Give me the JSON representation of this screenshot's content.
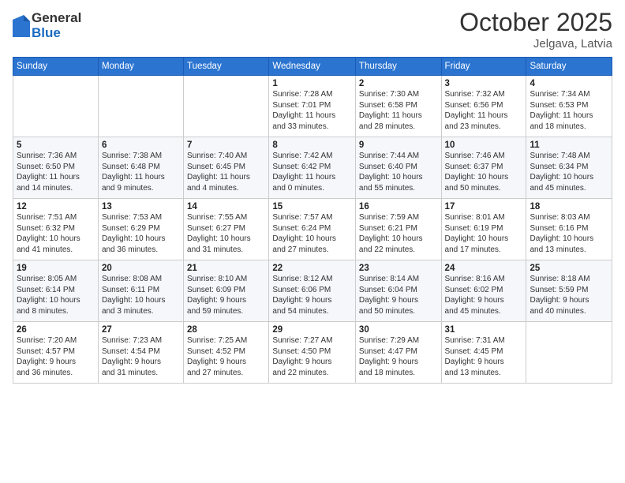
{
  "logo": {
    "general": "General",
    "blue": "Blue"
  },
  "header": {
    "month": "October 2025",
    "location": "Jelgava, Latvia"
  },
  "weekdays": [
    "Sunday",
    "Monday",
    "Tuesday",
    "Wednesday",
    "Thursday",
    "Friday",
    "Saturday"
  ],
  "weeks": [
    [
      {
        "day": "",
        "info": ""
      },
      {
        "day": "",
        "info": ""
      },
      {
        "day": "",
        "info": ""
      },
      {
        "day": "1",
        "info": "Sunrise: 7:28 AM\nSunset: 7:01 PM\nDaylight: 11 hours\nand 33 minutes."
      },
      {
        "day": "2",
        "info": "Sunrise: 7:30 AM\nSunset: 6:58 PM\nDaylight: 11 hours\nand 28 minutes."
      },
      {
        "day": "3",
        "info": "Sunrise: 7:32 AM\nSunset: 6:56 PM\nDaylight: 11 hours\nand 23 minutes."
      },
      {
        "day": "4",
        "info": "Sunrise: 7:34 AM\nSunset: 6:53 PM\nDaylight: 11 hours\nand 18 minutes."
      }
    ],
    [
      {
        "day": "5",
        "info": "Sunrise: 7:36 AM\nSunset: 6:50 PM\nDaylight: 11 hours\nand 14 minutes."
      },
      {
        "day": "6",
        "info": "Sunrise: 7:38 AM\nSunset: 6:48 PM\nDaylight: 11 hours\nand 9 minutes."
      },
      {
        "day": "7",
        "info": "Sunrise: 7:40 AM\nSunset: 6:45 PM\nDaylight: 11 hours\nand 4 minutes."
      },
      {
        "day": "8",
        "info": "Sunrise: 7:42 AM\nSunset: 6:42 PM\nDaylight: 11 hours\nand 0 minutes."
      },
      {
        "day": "9",
        "info": "Sunrise: 7:44 AM\nSunset: 6:40 PM\nDaylight: 10 hours\nand 55 minutes."
      },
      {
        "day": "10",
        "info": "Sunrise: 7:46 AM\nSunset: 6:37 PM\nDaylight: 10 hours\nand 50 minutes."
      },
      {
        "day": "11",
        "info": "Sunrise: 7:48 AM\nSunset: 6:34 PM\nDaylight: 10 hours\nand 45 minutes."
      }
    ],
    [
      {
        "day": "12",
        "info": "Sunrise: 7:51 AM\nSunset: 6:32 PM\nDaylight: 10 hours\nand 41 minutes."
      },
      {
        "day": "13",
        "info": "Sunrise: 7:53 AM\nSunset: 6:29 PM\nDaylight: 10 hours\nand 36 minutes."
      },
      {
        "day": "14",
        "info": "Sunrise: 7:55 AM\nSunset: 6:27 PM\nDaylight: 10 hours\nand 31 minutes."
      },
      {
        "day": "15",
        "info": "Sunrise: 7:57 AM\nSunset: 6:24 PM\nDaylight: 10 hours\nand 27 minutes."
      },
      {
        "day": "16",
        "info": "Sunrise: 7:59 AM\nSunset: 6:21 PM\nDaylight: 10 hours\nand 22 minutes."
      },
      {
        "day": "17",
        "info": "Sunrise: 8:01 AM\nSunset: 6:19 PM\nDaylight: 10 hours\nand 17 minutes."
      },
      {
        "day": "18",
        "info": "Sunrise: 8:03 AM\nSunset: 6:16 PM\nDaylight: 10 hours\nand 13 minutes."
      }
    ],
    [
      {
        "day": "19",
        "info": "Sunrise: 8:05 AM\nSunset: 6:14 PM\nDaylight: 10 hours\nand 8 minutes."
      },
      {
        "day": "20",
        "info": "Sunrise: 8:08 AM\nSunset: 6:11 PM\nDaylight: 10 hours\nand 3 minutes."
      },
      {
        "day": "21",
        "info": "Sunrise: 8:10 AM\nSunset: 6:09 PM\nDaylight: 9 hours\nand 59 minutes."
      },
      {
        "day": "22",
        "info": "Sunrise: 8:12 AM\nSunset: 6:06 PM\nDaylight: 9 hours\nand 54 minutes."
      },
      {
        "day": "23",
        "info": "Sunrise: 8:14 AM\nSunset: 6:04 PM\nDaylight: 9 hours\nand 50 minutes."
      },
      {
        "day": "24",
        "info": "Sunrise: 8:16 AM\nSunset: 6:02 PM\nDaylight: 9 hours\nand 45 minutes."
      },
      {
        "day": "25",
        "info": "Sunrise: 8:18 AM\nSunset: 5:59 PM\nDaylight: 9 hours\nand 40 minutes."
      }
    ],
    [
      {
        "day": "26",
        "info": "Sunrise: 7:20 AM\nSunset: 4:57 PM\nDaylight: 9 hours\nand 36 minutes."
      },
      {
        "day": "27",
        "info": "Sunrise: 7:23 AM\nSunset: 4:54 PM\nDaylight: 9 hours\nand 31 minutes."
      },
      {
        "day": "28",
        "info": "Sunrise: 7:25 AM\nSunset: 4:52 PM\nDaylight: 9 hours\nand 27 minutes."
      },
      {
        "day": "29",
        "info": "Sunrise: 7:27 AM\nSunset: 4:50 PM\nDaylight: 9 hours\nand 22 minutes."
      },
      {
        "day": "30",
        "info": "Sunrise: 7:29 AM\nSunset: 4:47 PM\nDaylight: 9 hours\nand 18 minutes."
      },
      {
        "day": "31",
        "info": "Sunrise: 7:31 AM\nSunset: 4:45 PM\nDaylight: 9 hours\nand 13 minutes."
      },
      {
        "day": "",
        "info": ""
      }
    ]
  ]
}
